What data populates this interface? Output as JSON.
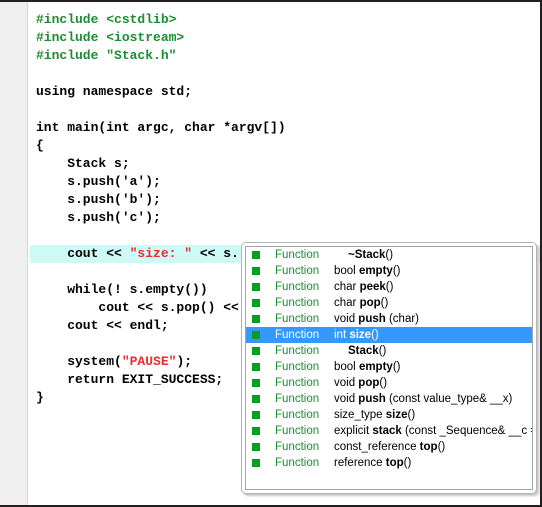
{
  "editor": {
    "language": "cpp",
    "gutter_color": "#efefef",
    "highlight_color": "#cdfaf6",
    "preprocessor_color": "#1a8e32",
    "string_color": "#ef2b2b",
    "lines": [
      {
        "id": 1,
        "highlighted": false,
        "segments": [
          {
            "text": "#include <cstdlib>",
            "type": "preprocessor"
          }
        ]
      },
      {
        "id": 2,
        "highlighted": false,
        "segments": [
          {
            "text": "#include <iostream>",
            "type": "preprocessor"
          }
        ]
      },
      {
        "id": 3,
        "highlighted": false,
        "segments": [
          {
            "text": "#include \"Stack.h\"",
            "type": "preprocessor"
          }
        ]
      },
      {
        "id": 4,
        "highlighted": false,
        "segments": [
          {
            "text": "",
            "type": "plain"
          }
        ]
      },
      {
        "id": 5,
        "highlighted": false,
        "segments": [
          {
            "text": "using namespace std;",
            "type": "plain"
          }
        ]
      },
      {
        "id": 6,
        "highlighted": false,
        "segments": [
          {
            "text": "",
            "type": "plain"
          }
        ]
      },
      {
        "id": 7,
        "highlighted": false,
        "segments": [
          {
            "text": "int main(int argc, char *argv[])",
            "type": "plain"
          }
        ]
      },
      {
        "id": 8,
        "highlighted": false,
        "segments": [
          {
            "text": "{",
            "type": "plain"
          }
        ]
      },
      {
        "id": 9,
        "highlighted": false,
        "segments": [
          {
            "text": "    Stack s;",
            "type": "plain"
          }
        ]
      },
      {
        "id": 10,
        "highlighted": false,
        "segments": [
          {
            "text": "    s.push('a');",
            "type": "plain"
          }
        ]
      },
      {
        "id": 11,
        "highlighted": false,
        "segments": [
          {
            "text": "    s.push('b');",
            "type": "plain"
          }
        ]
      },
      {
        "id": 12,
        "highlighted": false,
        "segments": [
          {
            "text": "    s.push('c');",
            "type": "plain"
          }
        ]
      },
      {
        "id": 13,
        "highlighted": false,
        "segments": [
          {
            "text": "",
            "type": "plain"
          }
        ]
      },
      {
        "id": 14,
        "highlighted": true,
        "segments": [
          {
            "text": "    cout << ",
            "type": "plain"
          },
          {
            "text": "\"size: \"",
            "type": "string"
          },
          {
            "text": " << s. << endl;",
            "type": "plain"
          }
        ]
      },
      {
        "id": 15,
        "highlighted": false,
        "segments": [
          {
            "text": "",
            "type": "plain"
          }
        ]
      },
      {
        "id": 16,
        "highlighted": false,
        "segments": [
          {
            "text": "    while(! s.empty())",
            "type": "plain"
          }
        ]
      },
      {
        "id": 17,
        "highlighted": false,
        "segments": [
          {
            "text": "        cout << s.pop() <<",
            "type": "plain"
          }
        ]
      },
      {
        "id": 18,
        "highlighted": false,
        "segments": [
          {
            "text": "    cout << endl;",
            "type": "plain"
          }
        ]
      },
      {
        "id": 19,
        "highlighted": false,
        "segments": [
          {
            "text": "",
            "type": "plain"
          }
        ]
      },
      {
        "id": 20,
        "highlighted": false,
        "segments": [
          {
            "text": "    system(",
            "type": "plain"
          },
          {
            "text": "\"PAUSE\"",
            "type": "string"
          },
          {
            "text": ");",
            "type": "plain"
          }
        ]
      },
      {
        "id": 21,
        "highlighted": false,
        "segments": [
          {
            "text": "    return EXIT_SUCCESS;",
            "type": "plain"
          }
        ]
      },
      {
        "id": 22,
        "highlighted": false,
        "segments": [
          {
            "text": "}",
            "type": "plain"
          }
        ]
      }
    ]
  },
  "autocomplete": {
    "selected_index": 5,
    "selection_color": "#3399ff",
    "kind_color": "#1a8e32",
    "icon_color": "#0a9d1e",
    "icon_name": "green-square-function-icon",
    "items": [
      {
        "kind": "Function",
        "indent": true,
        "return_type": "",
        "name": "~Stack",
        "params": "()"
      },
      {
        "kind": "Function",
        "indent": false,
        "return_type": "bool ",
        "name": "empty",
        "params": "()"
      },
      {
        "kind": "Function",
        "indent": false,
        "return_type": "char ",
        "name": "peek",
        "params": "()"
      },
      {
        "kind": "Function",
        "indent": false,
        "return_type": "char ",
        "name": "pop",
        "params": "()"
      },
      {
        "kind": "Function",
        "indent": false,
        "return_type": "void ",
        "name": "push",
        "params": " (char)"
      },
      {
        "kind": "Function",
        "indent": false,
        "return_type": "int ",
        "name": "size",
        "params": "()"
      },
      {
        "kind": "Function",
        "indent": true,
        "return_type": "",
        "name": "Stack",
        "params": "()"
      },
      {
        "kind": "Function",
        "indent": false,
        "return_type": "bool ",
        "name": "empty",
        "params": "()"
      },
      {
        "kind": "Function",
        "indent": false,
        "return_type": "void ",
        "name": "pop",
        "params": "()"
      },
      {
        "kind": "Function",
        "indent": false,
        "return_type": "void ",
        "name": "push",
        "params": " (const value_type& __x)"
      },
      {
        "kind": "Function",
        "indent": false,
        "return_type": "size_type ",
        "name": "size",
        "params": "()"
      },
      {
        "kind": "Function",
        "indent": false,
        "return_type": "explicit ",
        "name": "stack",
        "params": " (const _Sequence& __c ="
      },
      {
        "kind": "Function",
        "indent": false,
        "return_type": "const_reference ",
        "name": "top",
        "params": "()"
      },
      {
        "kind": "Function",
        "indent": false,
        "return_type": "reference ",
        "name": "top",
        "params": "()"
      }
    ]
  }
}
